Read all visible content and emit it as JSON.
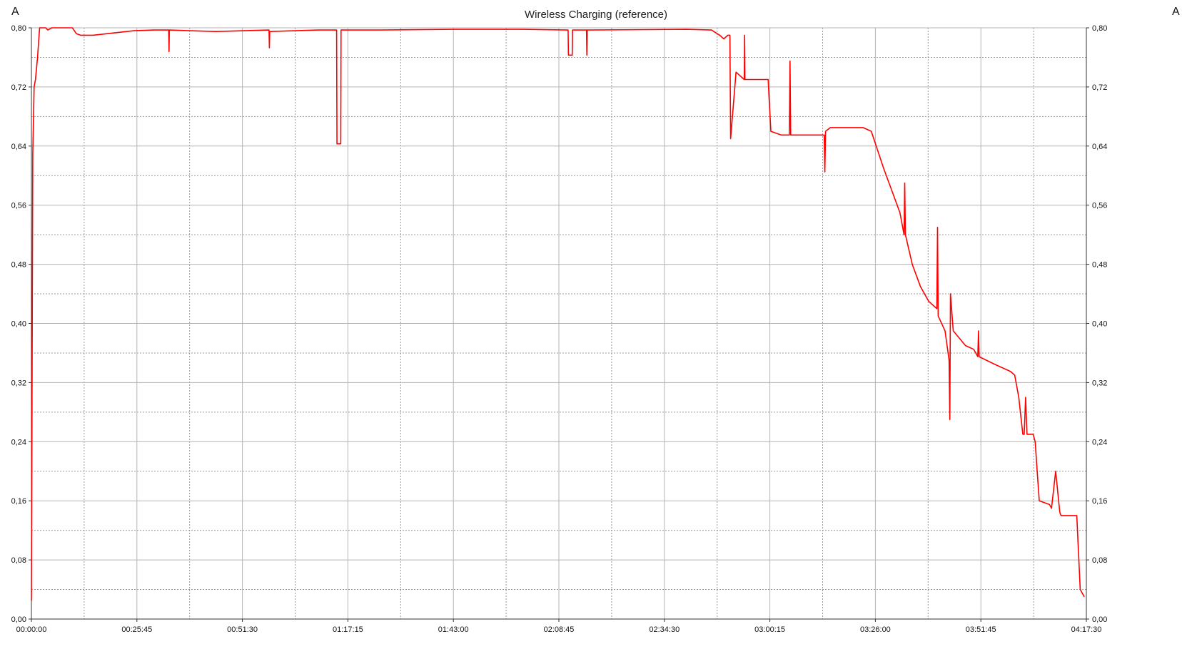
{
  "chart_data": {
    "type": "line",
    "title": "Wireless Charging (reference)",
    "ylabel_left": "A",
    "ylabel_right": "A",
    "xlabel": "",
    "x_unit": "h:mm:ss",
    "ylim": [
      0,
      0.8
    ],
    "xlim": [
      "00:00:00",
      "04:17:30"
    ],
    "y_ticks": [
      "0,00",
      "0,08",
      "0,16",
      "0,24",
      "0,32",
      "0,40",
      "0,48",
      "0,56",
      "0,64",
      "0,72",
      "0,80"
    ],
    "x_ticks": [
      "00:00:00",
      "00:25:45",
      "00:51:30",
      "01:17:15",
      "01:43:00",
      "02:08:45",
      "02:34:30",
      "03:00:15",
      "03:26:00",
      "03:51:45",
      "04:17:30"
    ],
    "grid": true,
    "series": [
      {
        "color": "#ff0000",
        "x": [
          "00:00:00",
          "00:00:20",
          "00:00:40",
          "00:01:00",
          "00:01:30",
          "00:02:00",
          "00:03:30",
          "00:04:00",
          "00:05:00",
          "00:10:00",
          "00:11:00",
          "00:12:00",
          "00:15:00",
          "00:25:00",
          "00:30:00",
          "00:33:30",
          "00:33:35",
          "00:33:40",
          "00:45:00",
          "00:58:00",
          "00:58:05",
          "00:58:10",
          "01:10:00",
          "01:14:30",
          "01:14:35",
          "01:15:30",
          "01:15:35",
          "01:25:00",
          "01:43:00",
          "02:00:00",
          "02:11:00",
          "02:11:05",
          "02:12:00",
          "02:12:05",
          "02:15:30",
          "02:15:35",
          "02:15:40",
          "02:40:00",
          "02:46:00",
          "02:48:00",
          "02:49:00",
          "02:50:00",
          "02:50:30",
          "02:50:40",
          "02:52:00",
          "02:54:00",
          "02:54:05",
          "02:54:10",
          "02:57:00",
          "02:59:50",
          "03:00:00",
          "03:00:30",
          "03:03:00",
          "03:05:00",
          "03:05:10",
          "03:05:20",
          "03:07:00",
          "03:12:00",
          "03:13:30",
          "03:13:40",
          "03:13:50",
          "03:15:00",
          "03:19:00",
          "03:20:00",
          "03:23:00",
          "03:25:00",
          "03:26:30",
          "03:28:00",
          "03:30:00",
          "03:32:00",
          "03:33:00",
          "03:33:10",
          "03:33:20",
          "03:35:00",
          "03:37:00",
          "03:39:00",
          "03:41:00",
          "03:41:10",
          "03:41:20",
          "03:43:00",
          "03:44:00",
          "03:44:10",
          "03:44:20",
          "03:45:00",
          "03:48:00",
          "03:50:00",
          "03:51:00",
          "03:51:10",
          "03:51:20",
          "03:55:00",
          "03:59:00",
          "04:00:00",
          "04:01:00",
          "04:02:00",
          "04:02:20",
          "04:02:40",
          "04:03:00",
          "04:04:30",
          "04:05:00",
          "04:05:30",
          "04:06:00",
          "04:08:30",
          "04:09:00",
          "04:10:00",
          "04:11:00",
          "04:11:10",
          "04:11:20",
          "04:12:00",
          "04:15:00",
          "04:15:10",
          "04:15:30",
          "04:16:00",
          "04:17:00"
        ],
        "y": [
          0.025,
          0.63,
          0.72,
          0.73,
          0.76,
          0.8,
          0.8,
          0.797,
          0.8,
          0.8,
          0.792,
          0.79,
          0.79,
          0.796,
          0.797,
          0.797,
          0.768,
          0.797,
          0.795,
          0.797,
          0.773,
          0.795,
          0.797,
          0.797,
          0.643,
          0.643,
          0.797,
          0.797,
          0.798,
          0.798,
          0.797,
          0.763,
          0.763,
          0.797,
          0.797,
          0.763,
          0.797,
          0.798,
          0.797,
          0.79,
          0.785,
          0.79,
          0.79,
          0.65,
          0.74,
          0.73,
          0.79,
          0.73,
          0.73,
          0.73,
          0.71,
          0.66,
          0.655,
          0.655,
          0.755,
          0.655,
          0.655,
          0.655,
          0.655,
          0.605,
          0.66,
          0.665,
          0.665,
          0.665,
          0.665,
          0.66,
          0.635,
          0.61,
          0.58,
          0.55,
          0.52,
          0.59,
          0.52,
          0.48,
          0.45,
          0.43,
          0.42,
          0.53,
          0.41,
          0.39,
          0.35,
          0.27,
          0.44,
          0.39,
          0.37,
          0.365,
          0.355,
          0.39,
          0.355,
          0.345,
          0.335,
          0.33,
          0.3,
          0.25,
          0.25,
          0.3,
          0.25,
          0.25,
          0.24,
          0.2,
          0.16,
          0.155,
          0.15,
          0.2,
          0.145,
          0.142,
          0.14,
          0.14,
          0.14,
          0.14,
          0.1,
          0.04,
          0.03
        ]
      }
    ]
  }
}
